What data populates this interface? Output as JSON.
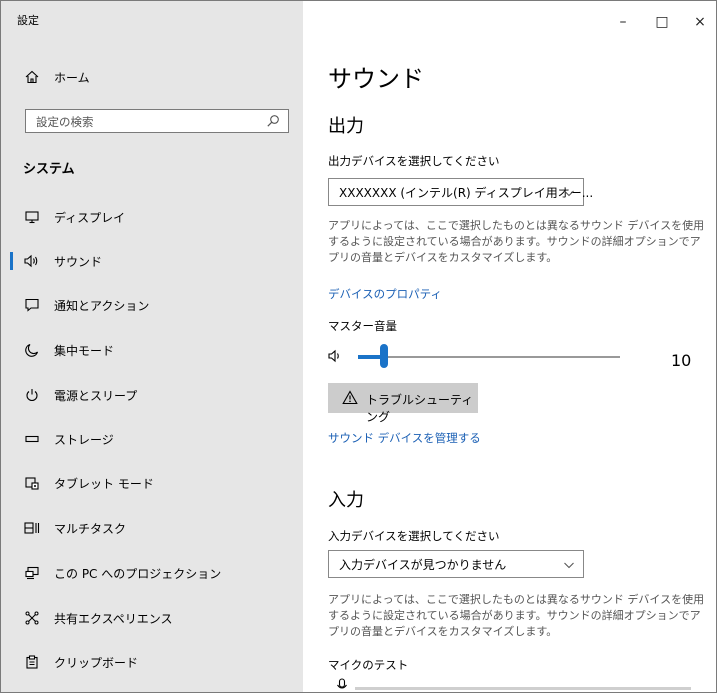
{
  "window": {
    "title": "設定",
    "minimize": "–",
    "maximize": "□",
    "close": "×"
  },
  "sidebar": {
    "home_label": "ホーム",
    "search_placeholder": "設定の検索",
    "section_title": "システム",
    "items": [
      {
        "label": "ディスプレイ",
        "icon": "monitor-icon"
      },
      {
        "label": "サウンド",
        "icon": "speaker-icon",
        "active": true
      },
      {
        "label": "通知とアクション",
        "icon": "notification-icon"
      },
      {
        "label": "集中モード",
        "icon": "moon-icon"
      },
      {
        "label": "電源とスリープ",
        "icon": "power-icon"
      },
      {
        "label": "ストレージ",
        "icon": "storage-icon"
      },
      {
        "label": "タブレット モード",
        "icon": "tablet-icon"
      },
      {
        "label": "マルチタスク",
        "icon": "multitask-icon"
      },
      {
        "label": "この PC へのプロジェクション",
        "icon": "projection-icon"
      },
      {
        "label": "共有エクスペリエンス",
        "icon": "shared-experience-icon"
      },
      {
        "label": "クリップボード",
        "icon": "clipboard-icon"
      }
    ]
  },
  "main": {
    "title": "サウンド",
    "output": {
      "heading": "出力",
      "device_label": "出力デバイスを選択してください",
      "device_value": "XXXXXXX (インテル(R) ディスプレイ用オー...",
      "description": "アプリによっては、ここで選択したものとは異なるサウンド デバイスを使用するように設定されている場合があります。サウンドの詳細オプションでアプリの音量とデバイスをカスタマイズします。",
      "properties_link": "デバイスのプロパティ",
      "master_volume_label": "マスター音量",
      "volume_value": "10",
      "volume_fraction": 0.1,
      "troubleshoot_label": "トラブルシューティング",
      "manage_link": "サウンド デバイスを管理する"
    },
    "input": {
      "heading": "入力",
      "device_label": "入力デバイスを選択してください",
      "device_value": "入力デバイスが見つかりません",
      "description": "アプリによっては、ここで選択したものとは異なるサウンド デバイスを使用するように設定されている場合があります。サウンドの詳細オプションでアプリの音量とデバイスをカスタマイズします。",
      "mic_test_label": "マイクのテスト"
    }
  },
  "colors": {
    "accent": "#1a73c8",
    "link": "#1a5fb4",
    "sidebar_bg": "#e6e6e6",
    "button_bg": "#cccccc"
  }
}
